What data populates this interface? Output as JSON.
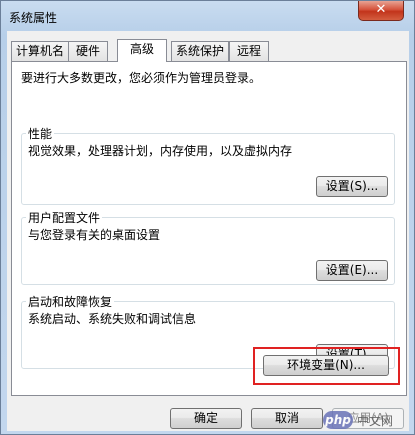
{
  "window": {
    "title": "系统属性",
    "close_symbol": "✕"
  },
  "tabs": [
    {
      "label": "计算机名",
      "active": false
    },
    {
      "label": "硬件",
      "active": false
    },
    {
      "label": "高级",
      "active": true
    },
    {
      "label": "系统保护",
      "active": false
    },
    {
      "label": "远程",
      "active": false
    }
  ],
  "advanced": {
    "admin_note": "要进行大多数更改，您必须作为管理员登录。",
    "performance": {
      "title": "性能",
      "description": "视觉效果，处理器计划，内存使用，以及虚拟内存",
      "button": "设置(S)..."
    },
    "user_profiles": {
      "title": "用户配置文件",
      "description": "与您登录有关的桌面设置",
      "button": "设置(E)..."
    },
    "startup_recovery": {
      "title": "启动和故障恢复",
      "description": "系统启动、系统失败和调试信息",
      "button": "设置(T)..."
    },
    "env_vars_button": "环境变量(N)..."
  },
  "footer": {
    "ok": "确定",
    "cancel": "取消",
    "apply": "应用(A)"
  },
  "watermark": {
    "logo": "php",
    "text": "中文网"
  },
  "colors": {
    "highlight": "#e02222",
    "close_button": "#c2341b"
  }
}
